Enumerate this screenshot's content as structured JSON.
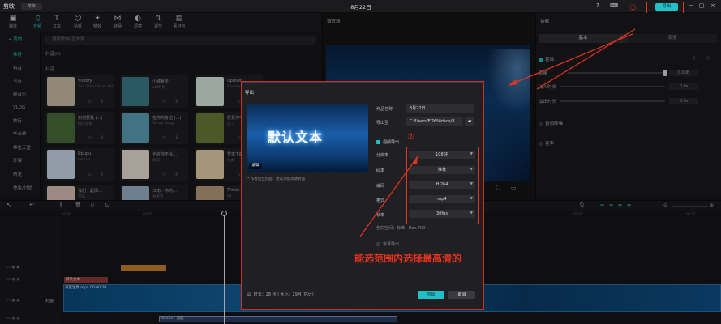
{
  "titlebar": {
    "logo": "剪映",
    "menu": "菜单",
    "window_title": "8月22日",
    "export_label": "导出",
    "circled_one": "①"
  },
  "toolbar": {
    "items": [
      {
        "label": "媒体",
        "icon": "media-icon"
      },
      {
        "label": "音频",
        "icon": "audio-icon"
      },
      {
        "label": "文本",
        "icon": "text-icon"
      },
      {
        "label": "贴纸",
        "icon": "sticker-icon"
      },
      {
        "label": "特效",
        "icon": "effects-icon"
      },
      {
        "label": "转场",
        "icon": "transition-icon"
      },
      {
        "label": "滤镜",
        "icon": "filter-icon"
      },
      {
        "label": "调节",
        "icon": "adjust-icon"
      },
      {
        "label": "素材包",
        "icon": "package-icon"
      }
    ]
  },
  "leftnav": {
    "header": "+ 我的",
    "items": [
      "推荐",
      "抖音",
      "卡点",
      "纯音乐",
      "VLOG",
      "旅行",
      "毕业季",
      "章鱼天堂",
      "环保",
      "萌宠",
      "美妆/时尚"
    ]
  },
  "library": {
    "search_placeholder": "搜索歌曲/艺术家",
    "tagline": "抖音(0)",
    "section": "抖音",
    "cards": [
      {
        "title": "Victory",
        "sub": "Two Steps From Hell",
        "color": "#c9bda5"
      },
      {
        "title": "小城夏天",
        "sub": "LBI利比",
        "color": "#3b7a8a"
      },
      {
        "title": "Uptown",
        "sub": "Eleanor",
        "color": "#d9e8e0"
      },
      {
        "title": "如何要我 (…)",
        "sub": "晓月老板",
        "color": "#4a6b3a"
      },
      {
        "title": "在你的身边 (…)",
        "sub": "Tonny Dogg",
        "color": "#5aa0b8"
      },
      {
        "title": "我爱你不是…",
        "sub": "虎二",
        "color": "#6b7a3a"
      },
      {
        "title": "Upupu",
        "sub": "Lemon",
        "color": "#c9d8ea"
      },
      {
        "title": "也许你不会…",
        "sub": "彦辰",
        "color": "#e8e0d5"
      },
      {
        "title": "雪落下的声…",
        "sub": "陆虎",
        "color": "#e3d2a8"
      },
      {
        "title": "我们一起闯…",
        "sub": "音乐",
        "color": "#d8c0b8"
      },
      {
        "title": "江南 - 你的…",
        "sub": "林俊杰",
        "color": "#9bb0c8"
      },
      {
        "title": "Tiktok…",
        "sub": "DJ",
        "color": "#b89a7a"
      }
    ],
    "card_icons": "☆ ⇩"
  },
  "player": {
    "title": "播放器"
  },
  "right_panel": {
    "title": "音频",
    "tabs": [
      "基本",
      "变速"
    ],
    "basic": "基础",
    "volume_label": "音量",
    "volume_value": "0.0dB",
    "fadein_label": "淡入时长",
    "fadein_value": "0.0s",
    "fadeout_label": "淡出时长",
    "fadeout_value": "0.0s",
    "denoise": "音频降噪",
    "voice_change": "变声"
  },
  "timeline": {
    "ruler": [
      "00:00",
      "00:05",
      "00:10",
      "00:15",
      "00:20",
      "00:25"
    ],
    "red_clip": "默认文本",
    "main_clip_label": "海底世界.mp4  00:00:29",
    "bottom_clip": "Ocean · 海底",
    "cover_label": "封面"
  },
  "dialog": {
    "title": "导出",
    "cover_text": "默认文本",
    "cover_edit": "编辑",
    "cover_note": "* 作者设立封面，建议添加高清封面",
    "name_label": "作品名称",
    "name_value": "8月22日",
    "path_label": "导出至",
    "path_value": "C:/Users/EDY/Videos/8...",
    "video_export": "视频导出",
    "resolution_label": "分辨率",
    "resolution_value": "1080P",
    "bitrate_label": "码率",
    "bitrate_value": "推荐",
    "codec_label": "编码",
    "codec_value": "H.264",
    "format_label": "格式",
    "format_value": "mp4",
    "fps_label": "帧率",
    "fps_value": "30fps",
    "color_space": "色彩空间：标准 - Rec.709",
    "subtitle_export": "字幕导出",
    "info": "时长：28 秒 | 大小：29M (估计)",
    "export_button": "导出",
    "cancel_button": "取消",
    "circled_two": "②"
  },
  "annotation": {
    "text": "能选范围内选择最高清的"
  }
}
